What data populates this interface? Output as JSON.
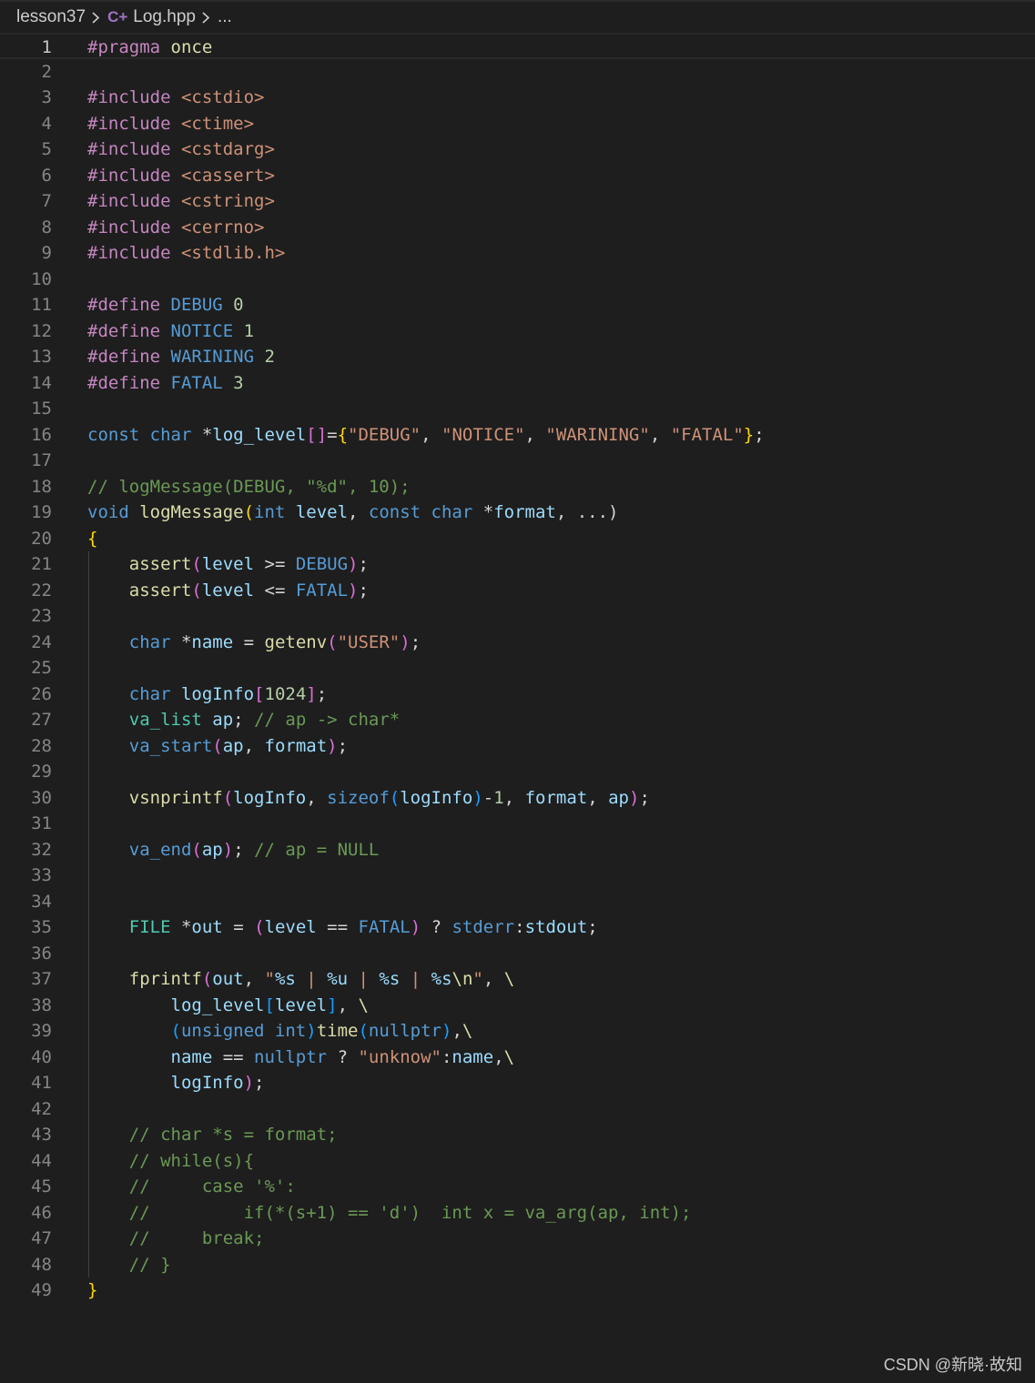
{
  "breadcrumb": {
    "folder": "lesson37",
    "file": "Log.hpp",
    "more": "..."
  },
  "editor": {
    "current_line": 1,
    "lines": [
      [
        [
          "k-pre",
          "#pragma "
        ],
        [
          "k-fn",
          "once"
        ]
      ],
      [],
      [
        [
          "k-pre",
          "#include "
        ],
        [
          "k-str",
          "<cstdio>"
        ]
      ],
      [
        [
          "k-pre",
          "#include "
        ],
        [
          "k-str",
          "<ctime>"
        ]
      ],
      [
        [
          "k-pre",
          "#include "
        ],
        [
          "k-str",
          "<cstdarg>"
        ]
      ],
      [
        [
          "k-pre",
          "#include "
        ],
        [
          "k-str",
          "<cassert>"
        ]
      ],
      [
        [
          "k-pre",
          "#include "
        ],
        [
          "k-str",
          "<cstring>"
        ]
      ],
      [
        [
          "k-pre",
          "#include "
        ],
        [
          "k-str",
          "<cerrno>"
        ]
      ],
      [
        [
          "k-pre",
          "#include "
        ],
        [
          "k-str",
          "<stdlib.h>"
        ]
      ],
      [],
      [
        [
          "k-pre",
          "#define "
        ],
        [
          "k-mac",
          "DEBUG "
        ],
        [
          "k-num",
          "0"
        ]
      ],
      [
        [
          "k-pre",
          "#define "
        ],
        [
          "k-mac",
          "NOTICE "
        ],
        [
          "k-num",
          "1"
        ]
      ],
      [
        [
          "k-pre",
          "#define "
        ],
        [
          "k-mac",
          "WARINING "
        ],
        [
          "k-num",
          "2"
        ]
      ],
      [
        [
          "k-pre",
          "#define "
        ],
        [
          "k-mac",
          "FATAL "
        ],
        [
          "k-num",
          "3"
        ]
      ],
      [],
      [
        [
          "k-kw",
          "const "
        ],
        [
          "k-kw",
          "char "
        ],
        [
          "k-p",
          "*"
        ],
        [
          "k-var",
          "log_level"
        ],
        [
          "k-b2",
          "[]"
        ],
        [
          "k-p",
          "="
        ],
        [
          "k-b1",
          "{"
        ],
        [
          "k-str",
          "\"DEBUG\""
        ],
        [
          "k-p",
          ", "
        ],
        [
          "k-str",
          "\"NOTICE\""
        ],
        [
          "k-p",
          ", "
        ],
        [
          "k-str",
          "\"WARINING\""
        ],
        [
          "k-p",
          ", "
        ],
        [
          "k-str",
          "\"FATAL\""
        ],
        [
          "k-b1",
          "}"
        ],
        [
          "k-p",
          ";"
        ]
      ],
      [],
      [
        [
          "k-cmt",
          "// logMessage(DEBUG, \"%d\", 10);"
        ]
      ],
      [
        [
          "k-kw",
          "void "
        ],
        [
          "k-fn",
          "logMessage"
        ],
        [
          "k-b1",
          "("
        ],
        [
          "k-kw",
          "int "
        ],
        [
          "k-var",
          "level"
        ],
        [
          "k-p",
          ", "
        ],
        [
          "k-kw",
          "const "
        ],
        [
          "k-kw",
          "char "
        ],
        [
          "k-p",
          "*"
        ],
        [
          "k-var",
          "format"
        ],
        [
          "k-p",
          ", ...)"
        ]
      ],
      [
        [
          "k-b1",
          "{"
        ]
      ],
      [
        [
          "k-p",
          "    "
        ],
        [
          "k-fn",
          "assert"
        ],
        [
          "k-b2",
          "("
        ],
        [
          "k-var",
          "level "
        ],
        [
          "k-p",
          ">= "
        ],
        [
          "k-mac",
          "DEBUG"
        ],
        [
          "k-b2",
          ")"
        ],
        [
          "k-p",
          ";"
        ]
      ],
      [
        [
          "k-p",
          "    "
        ],
        [
          "k-fn",
          "assert"
        ],
        [
          "k-b2",
          "("
        ],
        [
          "k-var",
          "level "
        ],
        [
          "k-p",
          "<= "
        ],
        [
          "k-mac",
          "FATAL"
        ],
        [
          "k-b2",
          ")"
        ],
        [
          "k-p",
          ";"
        ]
      ],
      [],
      [
        [
          "k-p",
          "    "
        ],
        [
          "k-kw",
          "char "
        ],
        [
          "k-p",
          "*"
        ],
        [
          "k-var",
          "name "
        ],
        [
          "k-p",
          "= "
        ],
        [
          "k-fn",
          "getenv"
        ],
        [
          "k-b2",
          "("
        ],
        [
          "k-str",
          "\"USER\""
        ],
        [
          "k-b2",
          ")"
        ],
        [
          "k-p",
          ";"
        ]
      ],
      [],
      [
        [
          "k-p",
          "    "
        ],
        [
          "k-kw",
          "char "
        ],
        [
          "k-var",
          "logInfo"
        ],
        [
          "k-b2",
          "["
        ],
        [
          "k-num",
          "1024"
        ],
        [
          "k-b2",
          "]"
        ],
        [
          "k-p",
          ";"
        ]
      ],
      [
        [
          "k-p",
          "    "
        ],
        [
          "k-type",
          "va_list "
        ],
        [
          "k-var",
          "ap"
        ],
        [
          "k-p",
          "; "
        ],
        [
          "k-cmt",
          "// ap -> char*"
        ]
      ],
      [
        [
          "k-p",
          "    "
        ],
        [
          "k-mac",
          "va_start"
        ],
        [
          "k-b2",
          "("
        ],
        [
          "k-var",
          "ap"
        ],
        [
          "k-p",
          ", "
        ],
        [
          "k-var",
          "format"
        ],
        [
          "k-b2",
          ")"
        ],
        [
          "k-p",
          ";"
        ]
      ],
      [],
      [
        [
          "k-p",
          "    "
        ],
        [
          "k-fn",
          "vsnprintf"
        ],
        [
          "k-b2",
          "("
        ],
        [
          "k-var",
          "logInfo"
        ],
        [
          "k-p",
          ", "
        ],
        [
          "k-kw",
          "sizeof"
        ],
        [
          "k-b3",
          "("
        ],
        [
          "k-var",
          "logInfo"
        ],
        [
          "k-b3",
          ")"
        ],
        [
          "k-p",
          "-"
        ],
        [
          "k-num",
          "1"
        ],
        [
          "k-p",
          ", "
        ],
        [
          "k-var",
          "format"
        ],
        [
          "k-p",
          ", "
        ],
        [
          "k-var",
          "ap"
        ],
        [
          "k-b2",
          ")"
        ],
        [
          "k-p",
          ";"
        ]
      ],
      [],
      [
        [
          "k-p",
          "    "
        ],
        [
          "k-mac",
          "va_end"
        ],
        [
          "k-b2",
          "("
        ],
        [
          "k-var",
          "ap"
        ],
        [
          "k-b2",
          ")"
        ],
        [
          "k-p",
          "; "
        ],
        [
          "k-cmt",
          "// ap = NULL"
        ]
      ],
      [],
      [],
      [
        [
          "k-p",
          "    "
        ],
        [
          "k-type",
          "FILE "
        ],
        [
          "k-p",
          "*"
        ],
        [
          "k-var",
          "out "
        ],
        [
          "k-p",
          "= "
        ],
        [
          "k-b2",
          "("
        ],
        [
          "k-var",
          "level "
        ],
        [
          "k-p",
          "== "
        ],
        [
          "k-mac",
          "FATAL"
        ],
        [
          "k-b2",
          ")"
        ],
        [
          "k-p",
          " ? "
        ],
        [
          "k-mac",
          "stderr"
        ],
        [
          "k-p",
          ":"
        ],
        [
          "k-var",
          "stdout"
        ],
        [
          "k-p",
          ";"
        ]
      ],
      [],
      [
        [
          "k-p",
          "    "
        ],
        [
          "k-fn",
          "fprintf"
        ],
        [
          "k-b2",
          "("
        ],
        [
          "k-var",
          "out"
        ],
        [
          "k-p",
          ", "
        ],
        [
          "k-str",
          "\""
        ],
        [
          "k-var",
          "%s"
        ],
        [
          "k-str",
          " | "
        ],
        [
          "k-var",
          "%u"
        ],
        [
          "k-str",
          " | "
        ],
        [
          "k-var",
          "%s"
        ],
        [
          "k-str",
          " | "
        ],
        [
          "k-var",
          "%s"
        ],
        [
          "k-fn",
          "\\n"
        ],
        [
          "k-str",
          "\""
        ],
        [
          "k-p",
          ", "
        ],
        [
          "k-fn",
          "\\"
        ]
      ],
      [
        [
          "k-p",
          "        "
        ],
        [
          "k-var",
          "log_level"
        ],
        [
          "k-b3",
          "["
        ],
        [
          "k-var",
          "level"
        ],
        [
          "k-b3",
          "]"
        ],
        [
          "k-p",
          ", "
        ],
        [
          "k-fn",
          "\\"
        ]
      ],
      [
        [
          "k-p",
          "        "
        ],
        [
          "k-b3",
          "("
        ],
        [
          "k-kw",
          "unsigned "
        ],
        [
          "k-kw",
          "int"
        ],
        [
          "k-b3",
          ")"
        ],
        [
          "k-fn",
          "time"
        ],
        [
          "k-b3",
          "("
        ],
        [
          "k-kw",
          "nullptr"
        ],
        [
          "k-b3",
          ")"
        ],
        [
          "k-p",
          ","
        ],
        [
          "k-fn",
          "\\"
        ]
      ],
      [
        [
          "k-p",
          "        "
        ],
        [
          "k-var",
          "name "
        ],
        [
          "k-p",
          "== "
        ],
        [
          "k-kw",
          "nullptr"
        ],
        [
          "k-p",
          " ? "
        ],
        [
          "k-str",
          "\"unknow\""
        ],
        [
          "k-p",
          ":"
        ],
        [
          "k-var",
          "name"
        ],
        [
          "k-p",
          ","
        ],
        [
          "k-fn",
          "\\"
        ]
      ],
      [
        [
          "k-p",
          "        "
        ],
        [
          "k-var",
          "logInfo"
        ],
        [
          "k-b2",
          ")"
        ],
        [
          "k-p",
          ";"
        ]
      ],
      [],
      [
        [
          "k-p",
          "    "
        ],
        [
          "k-cmt",
          "// char *s = format;"
        ]
      ],
      [
        [
          "k-p",
          "    "
        ],
        [
          "k-cmt",
          "// while(s){"
        ]
      ],
      [
        [
          "k-p",
          "    "
        ],
        [
          "k-cmt",
          "//     case '%':"
        ]
      ],
      [
        [
          "k-p",
          "    "
        ],
        [
          "k-cmt",
          "//         if(*(s+1) == 'd')  int x = va_arg(ap, int);"
        ]
      ],
      [
        [
          "k-p",
          "    "
        ],
        [
          "k-cmt",
          "//     break;"
        ]
      ],
      [
        [
          "k-p",
          "    "
        ],
        [
          "k-cmt",
          "// }"
        ]
      ],
      [
        [
          "k-b1",
          "}"
        ]
      ]
    ]
  },
  "watermark": "CSDN @新晓·故知"
}
